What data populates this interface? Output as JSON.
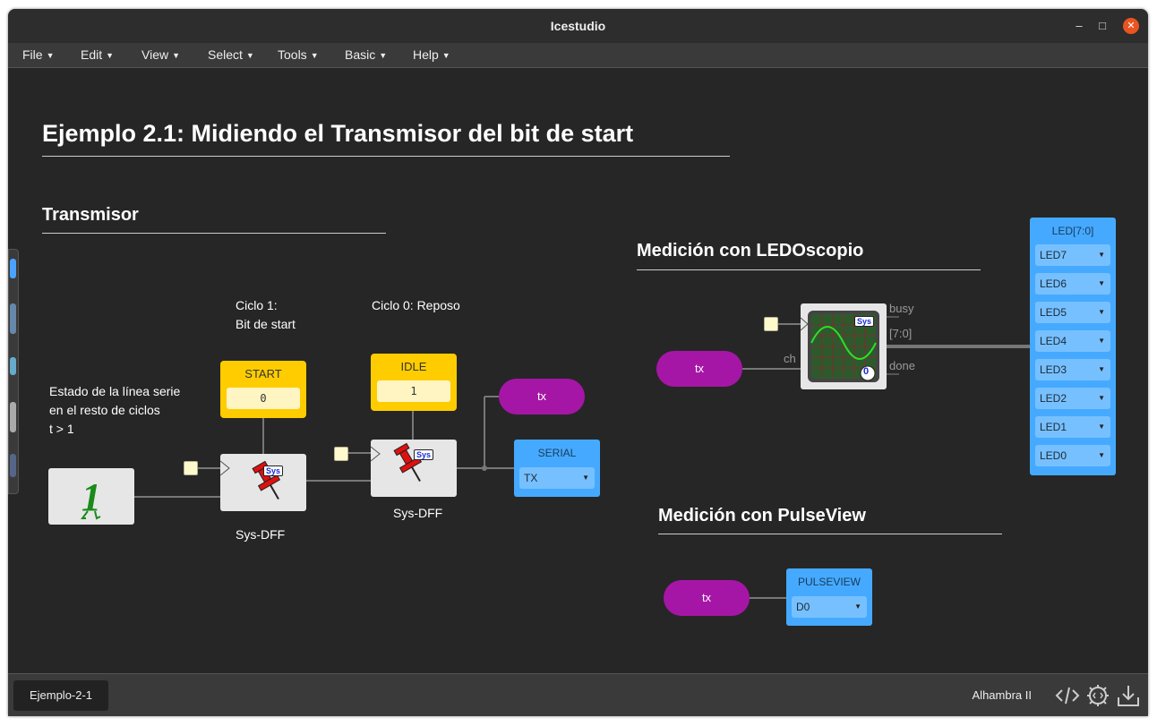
{
  "window": {
    "title": "Icestudio",
    "controls": {
      "minimize": "–",
      "maximize": "□",
      "close": "✕"
    }
  },
  "menu": {
    "file": "File",
    "edit": "Edit",
    "view": "View",
    "select": "Select",
    "tools": "Tools",
    "basic": "Basic",
    "help": "Help"
  },
  "canvas": {
    "main_title": "Ejemplo 2.1: Midiendo el Transmisor del bit de start",
    "transmisor_title": "Transmisor",
    "ledoscopio_title": "Medición con LEDOscopio",
    "pulseview_title": "Medición con PulseView",
    "note_ciclo1": [
      "Ciclo 1:",
      "Bit de start"
    ],
    "note_ciclo0": "Ciclo 0: Reposo",
    "note_estado": [
      "Estado de la línea serie",
      "en el resto de ciclos",
      "t > 1"
    ],
    "const_start": {
      "name": "START",
      "value": "0"
    },
    "const_idle": {
      "name": "IDLE",
      "value": "1"
    },
    "dff1_label": "Sys-DFF",
    "dff2_label": "Sys-DFF",
    "sys_badge": "Sys",
    "one_digit": "1",
    "tx_label": "tx",
    "serial": {
      "name": "SERIAL",
      "value": "TX"
    },
    "ledoscope": {
      "ports": {
        "busy": "busy",
        "bus": "[7:0]",
        "done": "done",
        "ch": "ch"
      },
      "badge": "Sys",
      "counter": "0"
    },
    "led_bus": {
      "name": "LED[7:0]",
      "items": [
        "LED7",
        "LED6",
        "LED5",
        "LED4",
        "LED3",
        "LED2",
        "LED1",
        "LED0"
      ]
    },
    "pulseview": {
      "name": "PULSEVIEW",
      "value": "D0"
    }
  },
  "colors": {
    "accent_constant": "#ffcc00",
    "input_pill": "#a616a6",
    "io_block": "#45aaff",
    "close_button": "#e95420"
  },
  "statusbar": {
    "tab_label": "Ejemplo-2-1",
    "board_name": "Alhambra II",
    "icons": [
      "code-icon",
      "settings-chip-icon",
      "download-icon"
    ]
  }
}
